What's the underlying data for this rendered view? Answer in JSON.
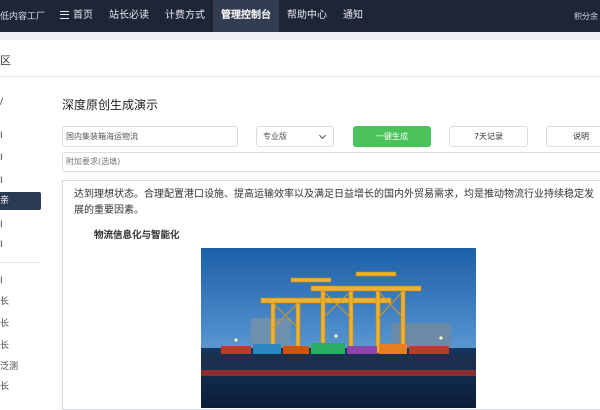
{
  "header": {
    "logo": "低内容工厂",
    "nav": [
      {
        "label": "首页",
        "icon": "home-icon"
      },
      {
        "label": "站长必读"
      },
      {
        "label": "计费方式"
      },
      {
        "label": "管理控制台",
        "active": true
      },
      {
        "label": "帮助中心"
      },
      {
        "label": "通知"
      }
    ],
    "points": "积分余"
  },
  "section": {
    "title": "区"
  },
  "sidebar": {
    "items": [
      {
        "label": "/"
      },
      {
        "label": "I"
      },
      {
        "label": "I"
      },
      {
        "label": "I"
      },
      {
        "label": "亲",
        "active": true
      },
      {
        "label": "I"
      },
      {
        "label": "I"
      },
      {
        "label": "I"
      },
      {
        "label": "长"
      },
      {
        "label": "长"
      },
      {
        "label": "长"
      },
      {
        "label": "泛测"
      },
      {
        "label": "长"
      }
    ]
  },
  "main": {
    "title": "深度原创生成演示",
    "topic_value": "国内集装箱海运物流",
    "version_select": "专业版",
    "generate_button": "一键生成",
    "records_button": "7天记录",
    "help_button": "说明",
    "extra_placeholder": "附加要求(选填)"
  },
  "article": {
    "paragraph": "达到理想状态。合理配置港口设施、提高运输效率以及满足日益增长的国内外贸易需求，均是推动物流行业持续稳定发展的重要因素。",
    "subheading": "物流信息化与智能化",
    "image": "container-port-cranes-photo"
  },
  "colors": {
    "topbar": "#1e2536",
    "nav_active": "#333d52",
    "generate_button": "#4cc35a",
    "sidebar_active": "#2c3a55"
  }
}
